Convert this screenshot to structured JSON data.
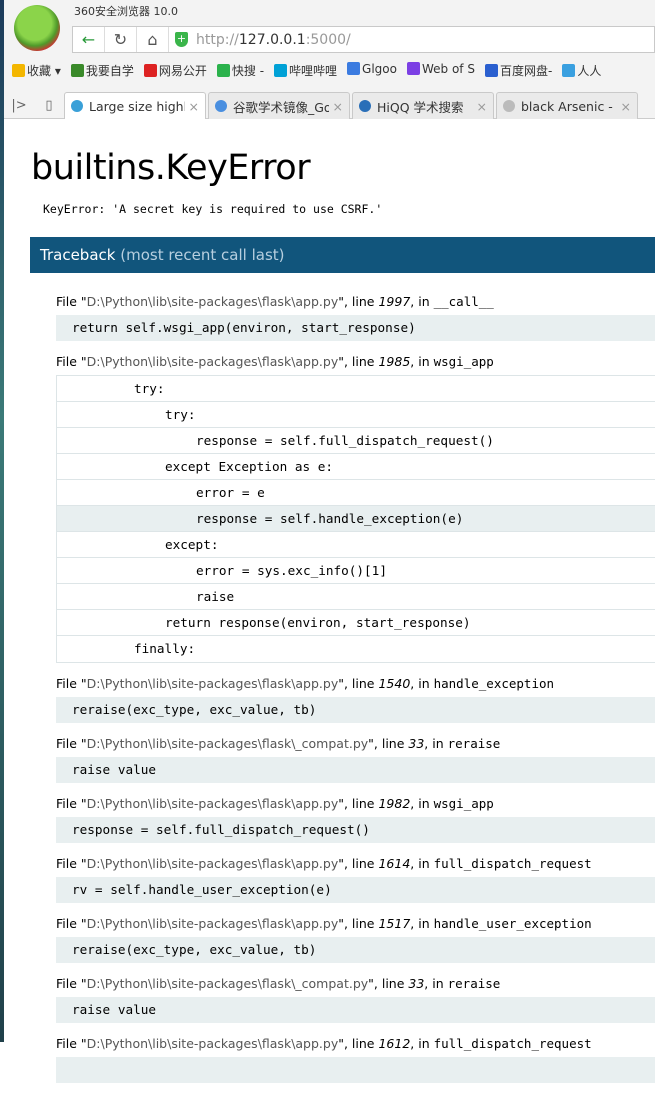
{
  "browser": {
    "title": "360安全浏览器 10.0",
    "url_prefix": "http://",
    "url_host": "127.0.0.1",
    "url_suffix": ":5000/",
    "bookmarks": [
      "收藏 ▾",
      "我要自学",
      "网易公开",
      "快搜 -",
      "哔哩哔哩",
      "Glgoo",
      "Web of S",
      "百度网盘-",
      "人人"
    ],
    "bookmark_colors": [
      "#f3b600",
      "#3a8a2a",
      "#d22",
      "#2bb24c",
      "#00a1d6",
      "#3b7be0",
      "#7b3fe4",
      "#2a5fcf",
      "#3aa0e0"
    ],
    "tabs": [
      {
        "label": "Large size highly",
        "active": true,
        "color": "#3aa0d8"
      },
      {
        "label": "谷歌学术镜像_Go",
        "active": false,
        "color": "#4a8fe0"
      },
      {
        "label": "HiQQ 学术搜索",
        "active": false,
        "color": "#2a6fb8"
      },
      {
        "label": "black Arsenic - ",
        "active": false,
        "color": "#bbb"
      }
    ]
  },
  "error": {
    "title": "builtins.KeyError",
    "message": "KeyError: 'A secret key is required to use CSRF.'"
  },
  "traceback": {
    "heading": "Traceback",
    "heading_note": "(most recent call last)",
    "frames": [
      {
        "file": "D:\\Python\\lib\\site-packages\\flask\\app.py",
        "line": "1997",
        "func": "__call__",
        "code": "return self.wsgi_app(environ, start_response)"
      },
      {
        "file": "D:\\Python\\lib\\site-packages\\flask\\app.py",
        "line": "1985",
        "func": "wsgi_app",
        "source": [
          {
            "text": "try:",
            "indent": 0
          },
          {
            "text": "try:",
            "indent": 1
          },
          {
            "text": "response = self.full_dispatch_request()",
            "indent": 2
          },
          {
            "text": "except Exception as e:",
            "indent": 1
          },
          {
            "text": "error = e",
            "indent": 2
          },
          {
            "text": "response = self.handle_exception(e)",
            "indent": 2,
            "current": true
          },
          {
            "text": "except:",
            "indent": 1
          },
          {
            "text": "error = sys.exc_info()[1]",
            "indent": 2
          },
          {
            "text": "raise",
            "indent": 2
          },
          {
            "text": "return response(environ, start_response)",
            "indent": 1
          },
          {
            "text": "finally:",
            "indent": 0
          }
        ]
      },
      {
        "file": "D:\\Python\\lib\\site-packages\\flask\\app.py",
        "line": "1540",
        "func": "handle_exception",
        "code": "reraise(exc_type, exc_value, tb)"
      },
      {
        "file": "D:\\Python\\lib\\site-packages\\flask\\_compat.py",
        "line": "33",
        "func": "reraise",
        "code": "raise value"
      },
      {
        "file": "D:\\Python\\lib\\site-packages\\flask\\app.py",
        "line": "1982",
        "func": "wsgi_app",
        "code": "response = self.full_dispatch_request()"
      },
      {
        "file": "D:\\Python\\lib\\site-packages\\flask\\app.py",
        "line": "1614",
        "func": "full_dispatch_request",
        "code": "rv = self.handle_user_exception(e)"
      },
      {
        "file": "D:\\Python\\lib\\site-packages\\flask\\app.py",
        "line": "1517",
        "func": "handle_user_exception",
        "code": "reraise(exc_type, exc_value, tb)"
      },
      {
        "file": "D:\\Python\\lib\\site-packages\\flask\\_compat.py",
        "line": "33",
        "func": "reraise",
        "code": "raise value"
      },
      {
        "file": "D:\\Python\\lib\\site-packages\\flask\\app.py",
        "line": "1612",
        "func": "full_dispatch_request",
        "code": ""
      }
    ]
  }
}
